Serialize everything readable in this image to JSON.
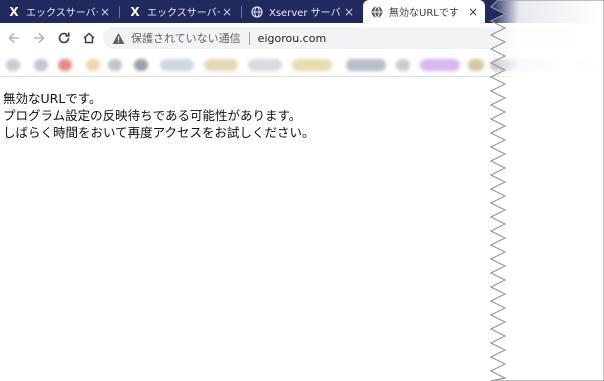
{
  "tabs": [
    {
      "title": "エックスサーバー｜",
      "favicon": "x-logo-icon",
      "close": "×"
    },
    {
      "title": "エックスサーバー契",
      "favicon": "x-logo-icon",
      "close": "×"
    },
    {
      "title": "Xserver サーバーパ",
      "favicon": "globe-icon",
      "close": "×"
    },
    {
      "title": "無効なURLです",
      "favicon": "globe-icon",
      "close": "×",
      "active": true
    }
  ],
  "toolbar": {
    "security_text": "保護されていない通信",
    "url": "eigorou.com"
  },
  "page": {
    "line1": "無効なURLです。",
    "line2": "プログラム設定の反映待ちである可能性があります。",
    "line3": "しばらく時間をおいて再度アクセスをお試しください。"
  },
  "colors": {
    "tabstrip": "#202a5e",
    "active_tab": "#ffffff",
    "omnibox": "#f1f3f4"
  }
}
